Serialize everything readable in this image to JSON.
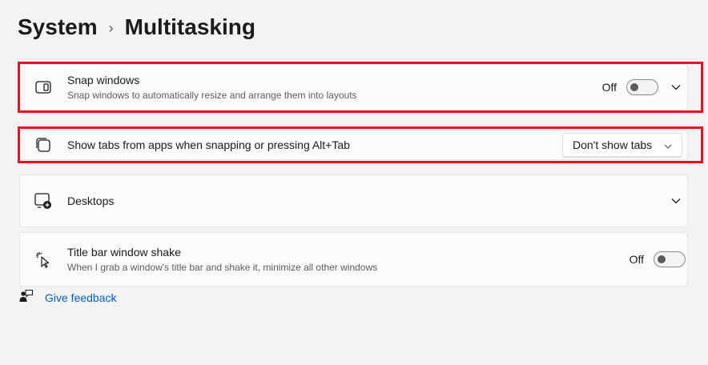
{
  "breadcrumb": {
    "parent": "System",
    "separator": "›",
    "current": "Multitasking"
  },
  "snap": {
    "title": "Snap windows",
    "subtitle": "Snap windows to automatically resize and arrange them into layouts",
    "toggle_label": "Off",
    "toggle_state": "off"
  },
  "tabs": {
    "title": "Show tabs from apps when snapping or pressing Alt+Tab",
    "dropdown_value": "Don't show tabs"
  },
  "desktops": {
    "title": "Desktops"
  },
  "shake": {
    "title": "Title bar window shake",
    "subtitle": "When I grab a window's title bar and shake it, minimize all other windows",
    "toggle_label": "Off",
    "toggle_state": "off"
  },
  "feedback": {
    "label": "Give feedback"
  },
  "colors": {
    "highlight": "#e81123",
    "link": "#005fb8",
    "background": "#f3f3f3"
  },
  "icons": {
    "snap": "snap-windows-icon",
    "tabs": "tabs-icon",
    "desktops": "desktops-icon",
    "shake": "window-shake-icon",
    "feedback": "feedback-icon",
    "chevron": "chevron-down-icon"
  }
}
